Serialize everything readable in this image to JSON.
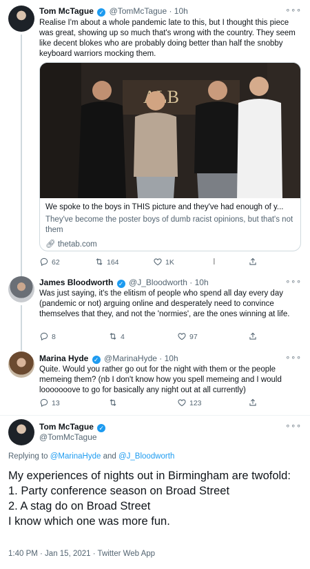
{
  "tweet1": {
    "name": "Tom McTague",
    "handle": "@TomMcTague",
    "time": "· 10h",
    "text": "Realise I'm about a whole pandemic late to this, but I thought this piece was great, showing up so much that's wrong with the country. They seem like decent blokes who are probably doing better than half the snobby keyboard warriors mocking them.",
    "card": {
      "sign": "ALB",
      "title": "We spoke to the boys in THIS picture and they've had enough of y...",
      "description": "They've become the poster boys of dumb racist opinions, but that's not them",
      "domain": "thetab.com"
    },
    "replies": "62",
    "retweets": "164",
    "likes": "1K"
  },
  "tweet2": {
    "name": "James Bloodworth",
    "handle": "@J_Bloodworth",
    "time": "· 10h",
    "text": "Was just saying, it's the elitism of people who spend all day every day (pandemic or not) arguing online and desperately need to convince themselves that they, and not the 'normies', are the ones winning at life.",
    "replies": "8",
    "retweets": "4",
    "likes": "97"
  },
  "tweet3": {
    "name": "Marina Hyde",
    "handle": "@MarinaHyde",
    "time": "· 10h",
    "text": "Quite. Would you rather go out for the night with them or the people memeing them? (nb I don't know how you spell memeing and I would looooooove to go for basically any night out at all currently)",
    "replies": "13",
    "retweets": "",
    "likes": "123"
  },
  "main_tweet": {
    "name": "Tom McTague",
    "handle": "@TomMcTague",
    "replying_prefix": "Replying to ",
    "mention1": "@MarinaHyde",
    "and": " and ",
    "mention2": "@J_Bloodworth",
    "lines": [
      "My experiences of nights out in Birmingham are twofold:",
      "1. Party conference season on Broad Street",
      "2. A stag do on Broad Street",
      "I know which one was more fun."
    ],
    "timestamp": "1:40 PM · Jan 15, 2021 · Twitter Web App"
  },
  "colors": {
    "accent": "#1d9bf0",
    "muted": "#536471",
    "text": "#0f1419",
    "border": "#cfd9de"
  },
  "icons": [
    "reply-icon",
    "retweet-icon",
    "like-icon",
    "share-icon",
    "more-icon",
    "verified-badge-icon",
    "link-icon",
    "cursor-icon"
  ]
}
